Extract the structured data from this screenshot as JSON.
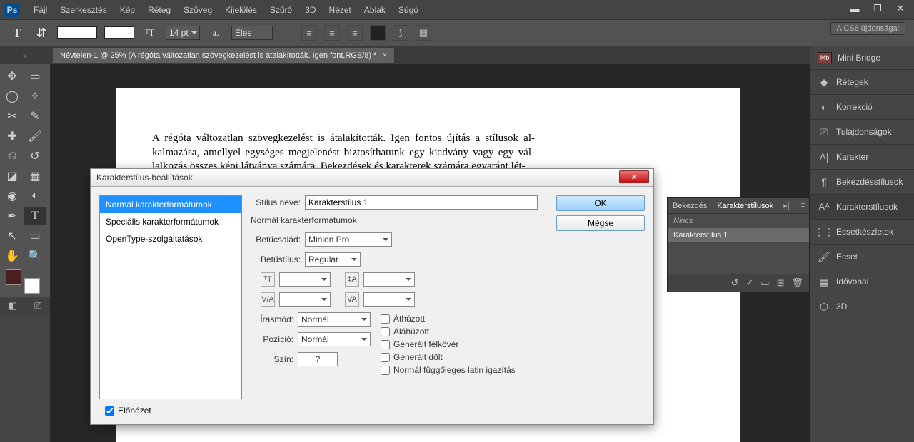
{
  "menubar": [
    "Fájl",
    "Szerkesztés",
    "Kép",
    "Réteg",
    "Szöveg",
    "Kijelölés",
    "Szűrő",
    "3D",
    "Nézet",
    "Ablak",
    "Súgó"
  ],
  "optbar": {
    "font_size": "14 pt",
    "aa": "Éles",
    "news": "A CS6 újdonságai"
  },
  "doc_tab": "Névtelen-1 @ 25% (A régóta változatlan szövegkezelést is átalakították. Igen font,RGB/8) *",
  "canvas_text": "A régóta változatlan szövegkezelést is átalakították. Igen fontos újítás a stílusok al- kalmazása, amellyel egységes megjelenést biztosíthatunk egy kiadvány vagy egy vál- lalkozás összes képi látványa számára. Bekezdések és karakterek számára egyaránt lét-",
  "dialog": {
    "title": "Karakterstílus-beállítások",
    "side": [
      "Normál karakterformátumok",
      "Speciális karakterformátumok",
      "OpenType-szolgáltatások"
    ],
    "name_label": "Stílus neve:",
    "name_value": "Karakterstílus 1",
    "subtitle": "Normál karakterformátumok",
    "family_label": "Betűcsalád:",
    "family_value": "Minion Pro",
    "style_label": "Betűstílus:",
    "style_value": "Regular",
    "script_label": "Írásmód:",
    "script_value": "Normál",
    "pos_label": "Pozíció:",
    "pos_value": "Normál",
    "color_label": "Szín:",
    "color_value": "?",
    "checks": [
      "Áthúzott",
      "Aláhúzott",
      "Generált félkövér",
      "Generált dőlt",
      "Normál függőleges latin igazítás"
    ],
    "ok": "OK",
    "cancel": "Mégse",
    "preview": "Előnézet"
  },
  "mini": {
    "tab1": "Bekezdés",
    "tab2": "Karakterstílusok",
    "none": "Nincs",
    "sel": "Karakterstílus 1+"
  },
  "rpanel": [
    "Mini Bridge",
    "Rétegek",
    "Korrekció",
    "Tulajdonságok",
    "Karakter",
    "Bekezdésstílusok",
    "Karakterstílusok",
    "Ecsetkészletek",
    "Ecset",
    "Idővonal",
    "3D"
  ]
}
